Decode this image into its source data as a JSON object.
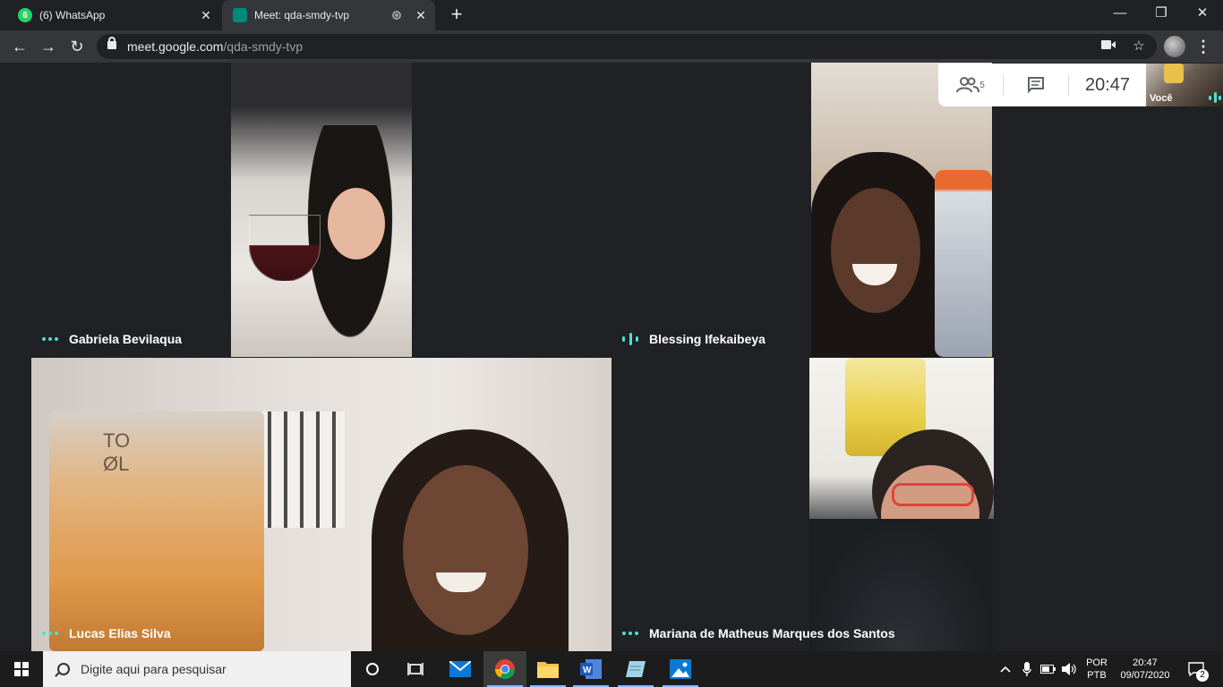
{
  "browser": {
    "tabs": [
      {
        "title": "(6) WhatsApp",
        "badge": "6",
        "favicon_color": "#25d366"
      },
      {
        "title": "Meet: qda-smdy-tvp",
        "favicon_color": "#00897b"
      }
    ],
    "url_host": "meet.google.com",
    "url_path": "/qda-smdy-tvp"
  },
  "meet": {
    "participants_count": "5",
    "time": "20:47",
    "self_label": "Você",
    "accent": "#4fe0d0",
    "tiles": [
      {
        "name": "Gabriela Bevilaqua",
        "status": "idle"
      },
      {
        "name": "Blessing Ifekaibeya",
        "status": "speaking"
      },
      {
        "name": "Lucas Elias Silva",
        "status": "idle"
      },
      {
        "name": "Mariana de Matheus Marques dos Santos",
        "status": "idle"
      }
    ]
  },
  "taskbar": {
    "search_placeholder": "Digite aqui para pesquisar",
    "apps": [
      "cortana-icon",
      "task-view-icon",
      "mail-icon",
      "chrome-icon",
      "file-explorer-icon",
      "word-icon",
      "notes-icon",
      "photos-icon"
    ],
    "language_line1": "POR",
    "language_line2": "PTB",
    "clock_time": "20:47",
    "clock_date": "09/07/2020",
    "notifications": "2"
  }
}
